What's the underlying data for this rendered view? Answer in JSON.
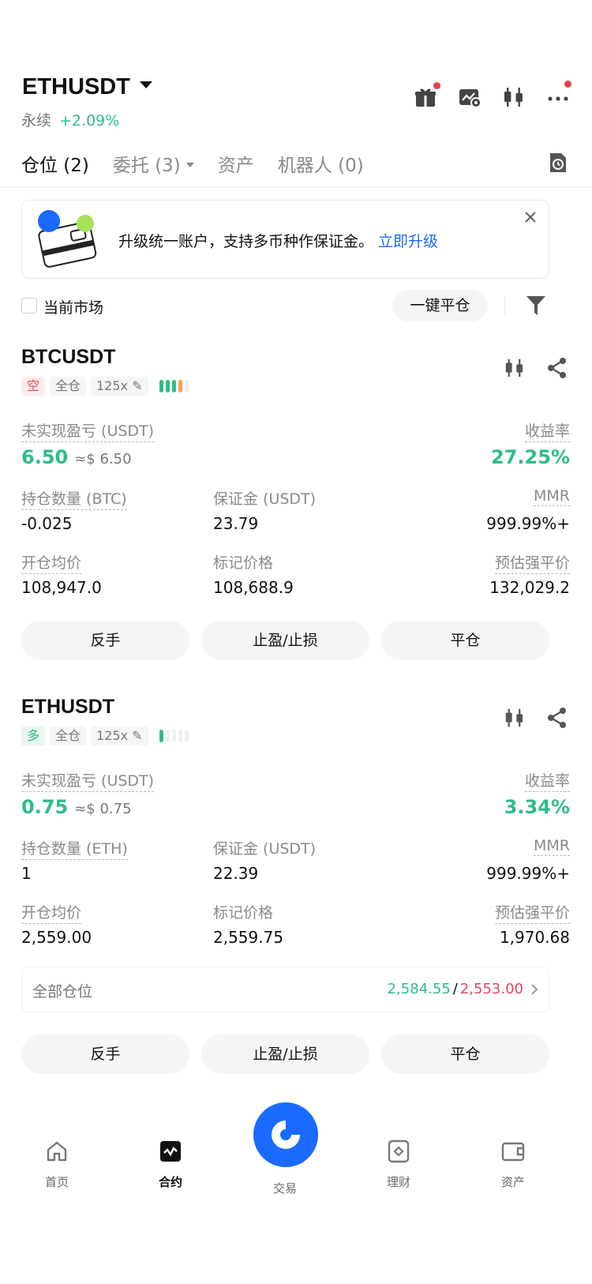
{
  "header": {
    "symbol": "ETHUSDT",
    "contract_type": "永续",
    "change": "+2.09%"
  },
  "tabs": {
    "positions": "仓位 (2)",
    "orders": "委托 (3)",
    "assets": "资产",
    "bots": "机器人 (0)"
  },
  "banner": {
    "text": "升级统一账户，支持多币种作保证金。",
    "link": "立即升级"
  },
  "filters": {
    "current_market": "当前市场",
    "close_all": "一键平仓"
  },
  "positions": [
    {
      "symbol": "BTCUSDT",
      "side": "空",
      "margin_mode": "全仓",
      "leverage": "125x",
      "pnl_label": "未实现盈亏 (USDT)",
      "pnl": "6.50",
      "pnl_approx": "≈$ 6.50",
      "roe_label": "收益率",
      "roe": "27.25%",
      "size_label": "持仓数量 (BTC)",
      "size": "-0.025",
      "margin_label": "保证金 (USDT)",
      "margin": "23.79",
      "mmr_label": "MMR",
      "mmr": "999.99%+",
      "entry_label": "开仓均价",
      "entry": "108,947.0",
      "mark_label": "标记价格",
      "mark": "108,688.9",
      "liq_label": "预估强平价",
      "liq": "132,029.2",
      "risk_level": 0.8
    },
    {
      "symbol": "ETHUSDT",
      "side": "多",
      "margin_mode": "全仓",
      "leverage": "125x",
      "pnl_label": "未实现盈亏 (USDT)",
      "pnl": "0.75",
      "pnl_approx": "≈$ 0.75",
      "roe_label": "收益率",
      "roe": "3.34%",
      "size_label": "持仓数量 (ETH)",
      "size": "1",
      "margin_label": "保证金 (USDT)",
      "margin": "22.39",
      "mmr_label": "MMR",
      "mmr": "999.99%+",
      "entry_label": "开仓均价",
      "entry": "2,559.00",
      "mark_label": "标记价格",
      "mark": "2,559.75",
      "liq_label": "预估强平价",
      "liq": "1,970.68",
      "risk_level": 0.2
    }
  ],
  "all_positions": {
    "label": "全部仓位",
    "tp": "2,584.55",
    "sep": "/",
    "sl": "2,553.00"
  },
  "actions": {
    "reverse": "反手",
    "tpsl": "止盈/止损",
    "close": "平仓"
  },
  "nav": {
    "home": "首页",
    "contract": "合约",
    "trade": "交易",
    "earn": "理财",
    "assets": "资产"
  },
  "colors": {
    "green": "#2ebd85",
    "red": "#e8455b",
    "orange": "#f7a25a",
    "brand_blue": "#1b6aff"
  }
}
